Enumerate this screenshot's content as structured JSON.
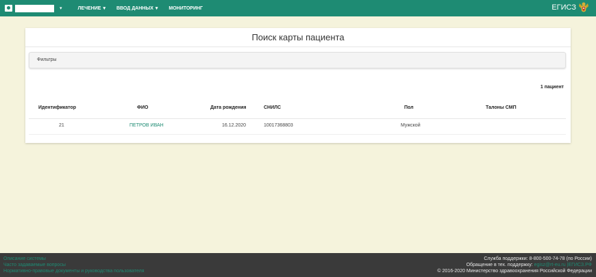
{
  "navbar": {
    "user_caret": "▾",
    "menu": [
      {
        "label": "ЛЕЧЕНИЕ",
        "caret": "▾"
      },
      {
        "label": "ВВОД ДАННЫХ",
        "caret": "▾"
      },
      {
        "label": "МОНИТОРИНГ",
        "caret": ""
      }
    ],
    "brand": "ЕГИСЗ",
    "colors": {
      "bar": "#1e8b73",
      "page_bg": "#f5f3dc",
      "footer_bg": "#3a3a3a"
    }
  },
  "main": {
    "title": "Поиск карты пациента",
    "filters_label": "Фильтры",
    "count": "1 пациент",
    "table": {
      "headers": [
        "Идентификатор",
        "ФИО",
        "Дата рождения",
        "СНИЛС",
        "Пол",
        "Талоны СМП"
      ],
      "rows": [
        {
          "id": "21",
          "fio": "ПЕТРОВ ИВАН",
          "birth_date": "16.12.2020",
          "snils": "10017368803",
          "sex": "Мужской",
          "smp": ""
        }
      ]
    }
  },
  "footer": {
    "links": [
      "Описание системы",
      "Часто задаваемые вопросы",
      "Нормативно-правовые документы и руководства пользователя"
    ],
    "support": "Служба поддержки: 8-800-500-74-78 (по России)",
    "contact_prefix": "Обращение в тех. поддержку:",
    "contact_email": "egisz@rt-eu.ru",
    "contact_sep": "|",
    "contact_site": "ЕГИСЗ.РФ",
    "copyright": "© 2016-2020 Министерство здравоохранения Российской Федерации"
  }
}
